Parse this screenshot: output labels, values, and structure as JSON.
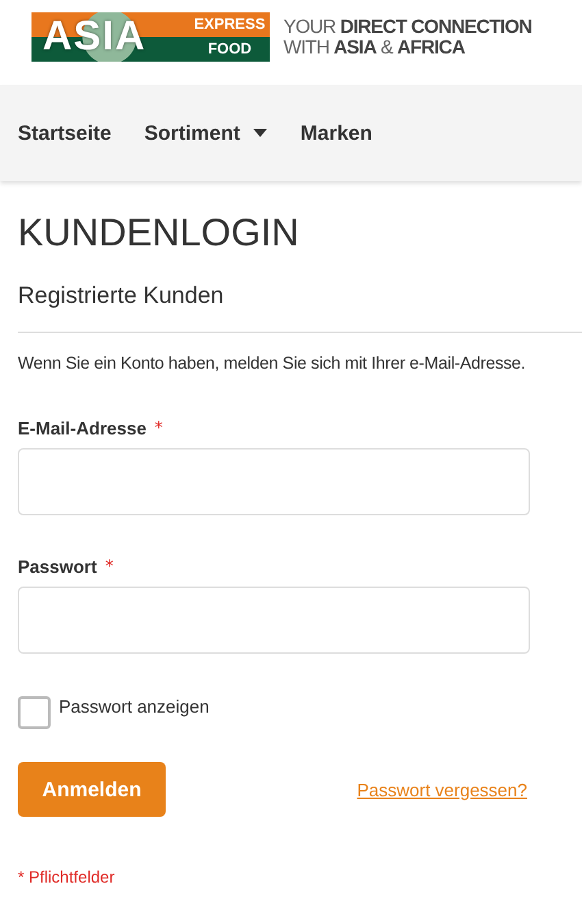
{
  "logo": {
    "word": "ASIA",
    "top": "EXPRESS",
    "bottom": "FOOD"
  },
  "tagline": [
    "YOUR **DIRECT CONNECTION**",
    "WITH **ASIA** & **AFRICA**"
  ],
  "nav": [
    {
      "label": "Startseite",
      "dropdown": false
    },
    {
      "label": "Sortiment",
      "dropdown": true
    },
    {
      "label": "Marken",
      "dropdown": false
    }
  ],
  "title": "KUNDENLOGIN",
  "section": "Registrierte Kunden",
  "intro": "Wenn Sie ein Konto haben, melden Sie sich mit Ihrer e-Mail-Adresse.",
  "fields": [
    {
      "label": "E-Mail-Adresse",
      "required_mark": "*"
    },
    {
      "label": "Passwort",
      "required_mark": "*"
    }
  ],
  "show_password": {
    "label": "Passwort anzeigen",
    "checked": false
  },
  "submit": "Anmelden",
  "forgot_link": "Passwort vergessen?",
  "required_note": "* Pflichtfelder"
}
